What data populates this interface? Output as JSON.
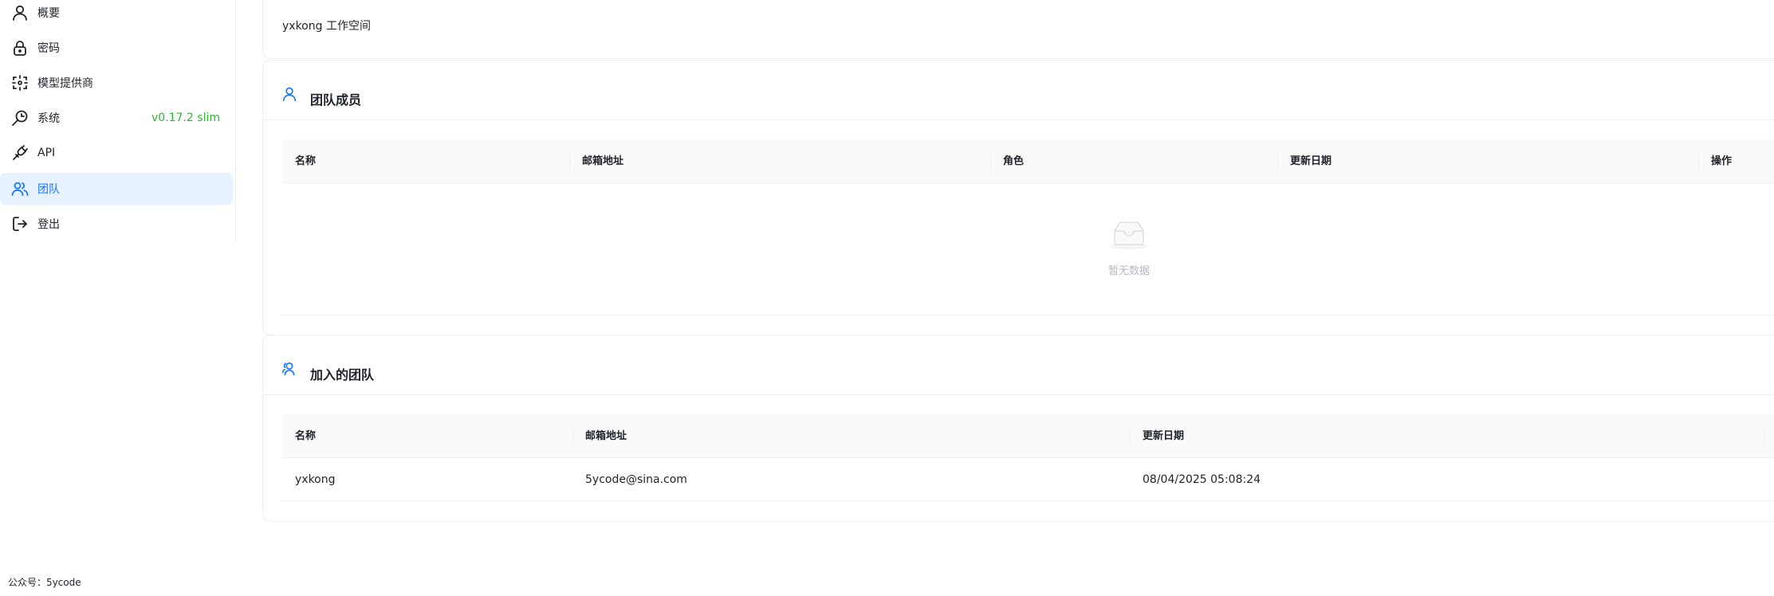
{
  "sidebar": {
    "items": [
      {
        "label": "概要",
        "icon": "user-icon"
      },
      {
        "label": "密码",
        "icon": "lock-icon"
      },
      {
        "label": "模型提供商",
        "icon": "model-provider-icon"
      },
      {
        "label": "系统",
        "icon": "system-icon",
        "badge": "v0.17.2 slim"
      },
      {
        "label": "API",
        "icon": "api-plug-icon"
      },
      {
        "label": "团队",
        "icon": "team-icon",
        "active": true
      },
      {
        "label": "登出",
        "icon": "logout-icon"
      }
    ]
  },
  "footer": {
    "note": "公众号：5ycode"
  },
  "workspace": {
    "name": "yxkong 工作空间"
  },
  "members": {
    "title": "团队成员",
    "columns": [
      "名称",
      "邮箱地址",
      "角色",
      "更新日期",
      "操作"
    ],
    "rows": [],
    "empty_text": "暂无数据"
  },
  "joined": {
    "title": "加入的团队",
    "columns": [
      "名称",
      "邮箱地址",
      "更新日期"
    ],
    "rows": [
      {
        "name": "yxkong",
        "email": "5ycode@sina.com",
        "updated": "08/04/2025 05:08:24"
      }
    ]
  },
  "colors": {
    "accent": "#1677ff",
    "active_bg": "#e6f2ff",
    "badge": "#30b335"
  }
}
